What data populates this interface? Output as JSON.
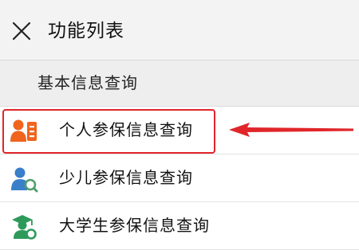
{
  "header": {
    "close_icon": "close-icon",
    "title": "功能列表"
  },
  "section": {
    "title": "基本信息查询"
  },
  "items": [
    {
      "label": "个人参保信息查询",
      "icon": "personal-card-icon",
      "color": "#f0641e"
    },
    {
      "label": "少儿参保信息查询",
      "icon": "child-search-icon",
      "color": "#3a7fc9"
    },
    {
      "label": "大学生参保信息查询",
      "icon": "graduate-search-icon",
      "color": "#2e9a5a"
    }
  ],
  "annotation": {
    "color": "#e0262a"
  }
}
